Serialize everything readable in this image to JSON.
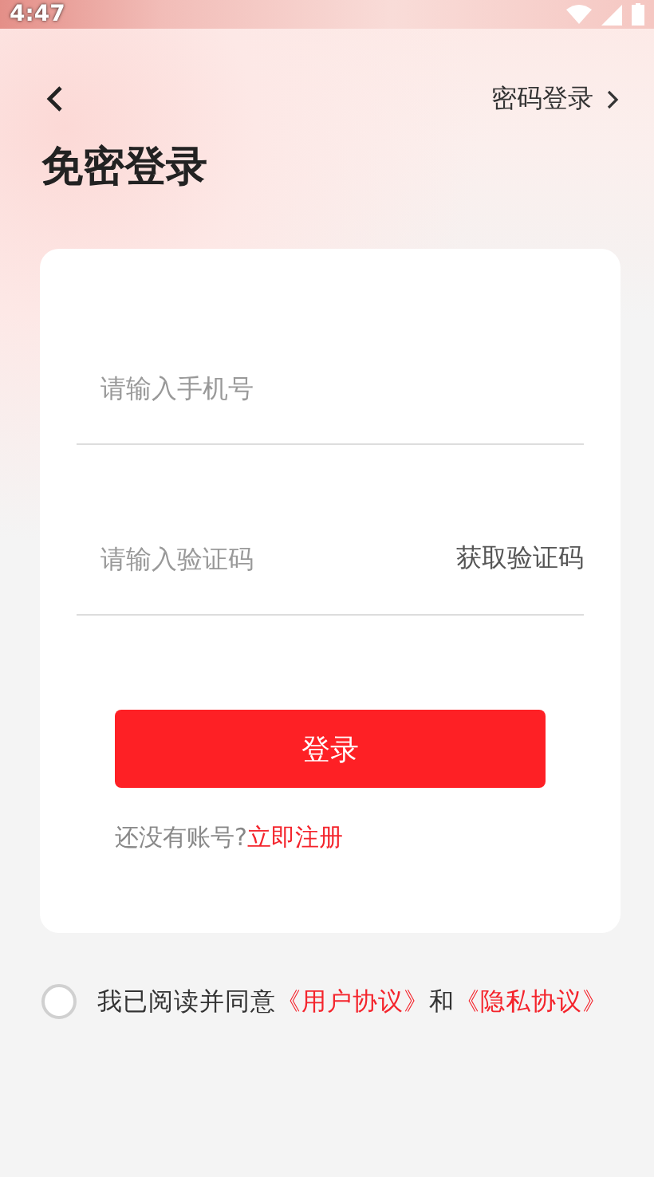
{
  "status_bar": {
    "time": "4:47"
  },
  "header": {
    "switch_link": "密码登录"
  },
  "title": "免密登录",
  "form": {
    "phone": {
      "placeholder": "请输入手机号"
    },
    "code": {
      "placeholder": "请输入验证码"
    },
    "get_code": "获取验证码",
    "submit": "登录",
    "register_prompt": "还没有账号?",
    "register_link": "立即注册"
  },
  "agreement": {
    "checked": false,
    "text": "我已阅读并同意",
    "user_agreement": "《用户协议》",
    "and": "和",
    "privacy_policy": "《隐私协议》"
  }
}
